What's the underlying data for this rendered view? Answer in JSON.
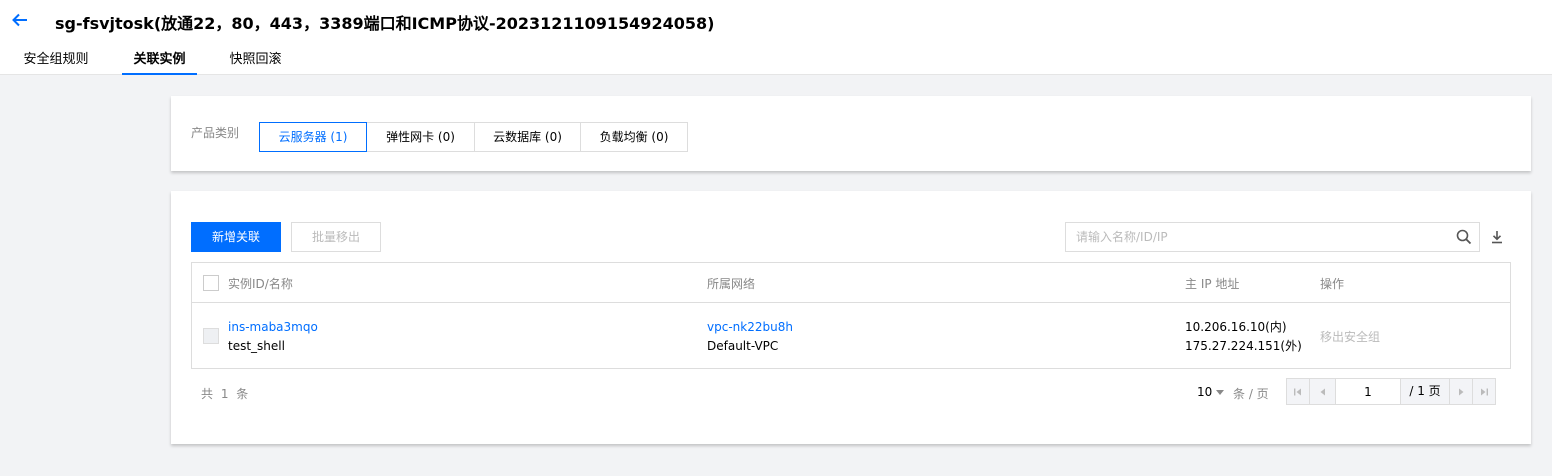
{
  "header": {
    "title": "sg-fsvjtosk(放通22，80，443，3389端口和ICMP协议-20231211091549‌24058)",
    "tabs": [
      {
        "label": "安全组规则",
        "active": false
      },
      {
        "label": "关联实例",
        "active": true
      },
      {
        "label": "快照回滚",
        "active": false
      }
    ]
  },
  "category": {
    "label": "产品类别",
    "options": [
      {
        "label": "云服务器 (1)",
        "active": true
      },
      {
        "label": "弹性网卡 (0)",
        "active": false
      },
      {
        "label": "云数据库 (0)",
        "active": false
      },
      {
        "label": "负载均衡 (0)",
        "active": false
      }
    ]
  },
  "toolbar": {
    "add_label": "新增关联",
    "batch_remove_label": "批量移出",
    "search_placeholder": "请输入名称/ID/IP"
  },
  "table": {
    "columns": [
      "实例ID/名称",
      "所属网络",
      "主 IP 地址",
      "操作"
    ],
    "rows": [
      {
        "instance_id": "ins-maba3mqo",
        "instance_name": "test_shell",
        "vpc_id": "vpc-nk22bu8h",
        "vpc_name": "Default-VPC",
        "private_ip": "10.206.16.10(内)",
        "public_ip": "175.27.224.151(外)",
        "action": "移出安全组"
      }
    ]
  },
  "footer": {
    "total": "共 1 条",
    "page_size": "10",
    "per_page_label": "条 / 页",
    "current_page": "1",
    "total_pages": "/ 1 页"
  },
  "colors": {
    "accent": "#006eff",
    "background": "#f2f3f5"
  }
}
